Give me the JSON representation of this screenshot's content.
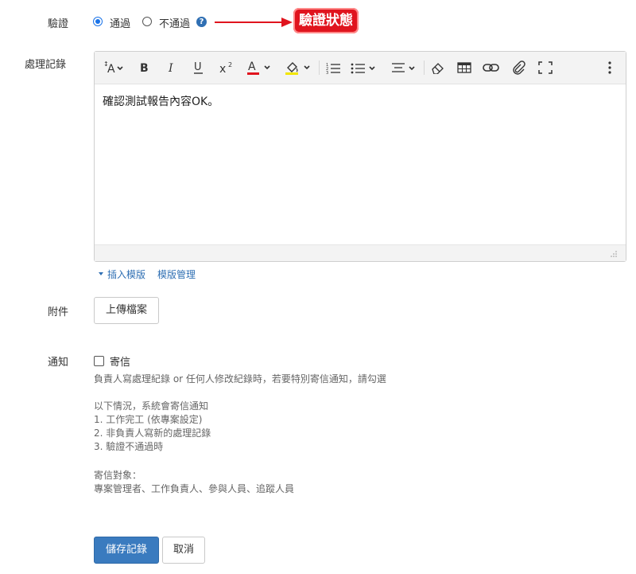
{
  "verify": {
    "label": "驗證",
    "options": [
      {
        "label": "通過",
        "checked": true
      },
      {
        "label": "不通過",
        "checked": false
      }
    ],
    "help_icon": "?",
    "annotation": "驗證狀態",
    "annotation_color": "#e0141e"
  },
  "record": {
    "label": "處理記錄",
    "content": "確認測試報告內容OK。",
    "toolbar": [
      "font-size-icon",
      "bold-icon",
      "italic-icon",
      "underline-icon",
      "superscript-icon",
      "font-color-icon",
      "highlight-icon",
      "ordered-list-icon",
      "bullet-list-icon",
      "align-icon",
      "eraser-icon",
      "table-icon",
      "link-icon",
      "attach-icon",
      "fullscreen-icon",
      "more-icon"
    ],
    "template_insert": "插入模版",
    "template_manage": "模版管理"
  },
  "attachment": {
    "label": "附件",
    "upload_button": "上傳檔案"
  },
  "notify": {
    "label": "通知",
    "checkbox_label": "寄信",
    "checked": false,
    "hint": "負責人寫處理紀錄 or 任何人修改紀錄時，若要特別寄信通知，請勾選",
    "conditions_title": "以下情況，系統會寄信通知",
    "conditions": [
      "1. 工作完工 (依專案設定)",
      "2. 非負責人寫新的處理記錄",
      "3. 驗證不通過時"
    ],
    "recipients_title": "寄信對象：",
    "recipients": "專案管理者、工作負責人、參與人員、追蹤人員"
  },
  "actions": {
    "save": "儲存記錄",
    "cancel": "取消",
    "primary_color": "#3a7bbf"
  }
}
